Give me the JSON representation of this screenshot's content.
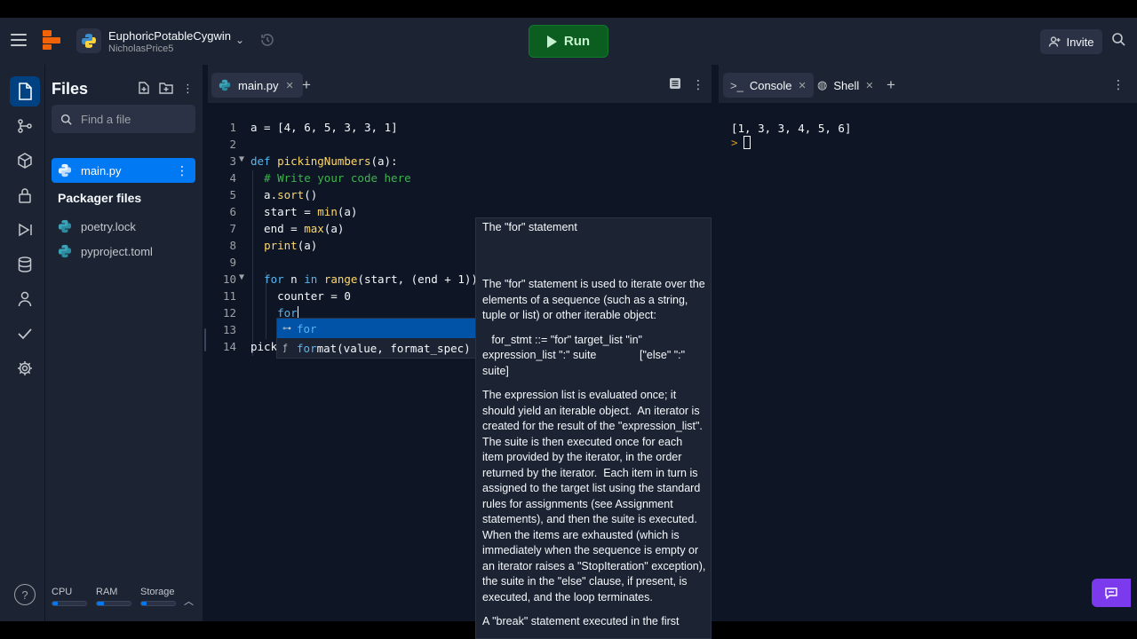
{
  "topbar": {
    "repl_name": "EuphoricPotableCygwin",
    "owner": "NicholasPrice5",
    "run_label": "Run",
    "invite_label": "Invite"
  },
  "files": {
    "title": "Files",
    "search_placeholder": "Find a file",
    "items": [
      {
        "name": "main.py"
      }
    ],
    "packager_title": "Packager files",
    "packager_items": [
      {
        "name": "poetry.lock"
      },
      {
        "name": "pyproject.toml"
      }
    ],
    "resources": {
      "cpu_label": "CPU",
      "cpu_level": 0.15,
      "ram_label": "RAM",
      "ram_level": 0.2,
      "storage_label": "Storage",
      "storage_level": 0.15
    }
  },
  "editor": {
    "tab_label": "main.py",
    "lines": [
      {
        "n": "1",
        "text": "a = [4, 6, 5, 3, 3, 1]"
      },
      {
        "n": "2",
        "text": ""
      },
      {
        "n": "3",
        "text": "def pickingNumbers(a):"
      },
      {
        "n": "4",
        "text": "  # Write your code here"
      },
      {
        "n": "5",
        "text": "  a.sort()"
      },
      {
        "n": "6",
        "text": "  start = min(a)"
      },
      {
        "n": "7",
        "text": "  end = max(a)"
      },
      {
        "n": "8",
        "text": "  print(a)"
      },
      {
        "n": "9",
        "text": ""
      },
      {
        "n": "10",
        "text": "  for n in range(start, (end + 1))"
      },
      {
        "n": "11",
        "text": "    counter = 0"
      },
      {
        "n": "12",
        "text": "    for"
      },
      {
        "n": "13",
        "text": ""
      },
      {
        "n": "14",
        "text": "pick"
      }
    ],
    "autocomplete": [
      {
        "kind": "key",
        "match": "for",
        "rest": ""
      },
      {
        "kind": "f",
        "match": "for",
        "rest": "mat(value, format_spec)"
      }
    ]
  },
  "docs": {
    "title": "The \"for\" statement",
    "paragraphs": [
      "The \"for\" statement is used to iterate over the elements of a sequence (such as a string, tuple or list) or other iterable object:",
      "   for_stmt ::= \"for\" target_list \"in\" expression_list \":\" suite              [\"else\" \":\" suite]",
      "The expression list is evaluated once; it should yield an iterable object.  An iterator is created for the result of the \"expression_list\".  The suite is then executed once for each item provided by the iterator, in the order returned by the iterator.  Each item in turn is assigned to the target list using the standard rules for assignments (see Assignment statements), and then the suite is executed.  When the items are exhausted (which is immediately when the sequence is empty or an iterator raises a \"StopIteration\" exception), the suite in the \"else\" clause, if present, is executed, and the loop terminates.",
      "A \"break\" statement executed in the first"
    ]
  },
  "console": {
    "tabs": [
      {
        "label": "Console"
      },
      {
        "label": "Shell"
      }
    ],
    "output": "[1, 3, 3, 4, 5, 6]",
    "prompt": ">"
  }
}
